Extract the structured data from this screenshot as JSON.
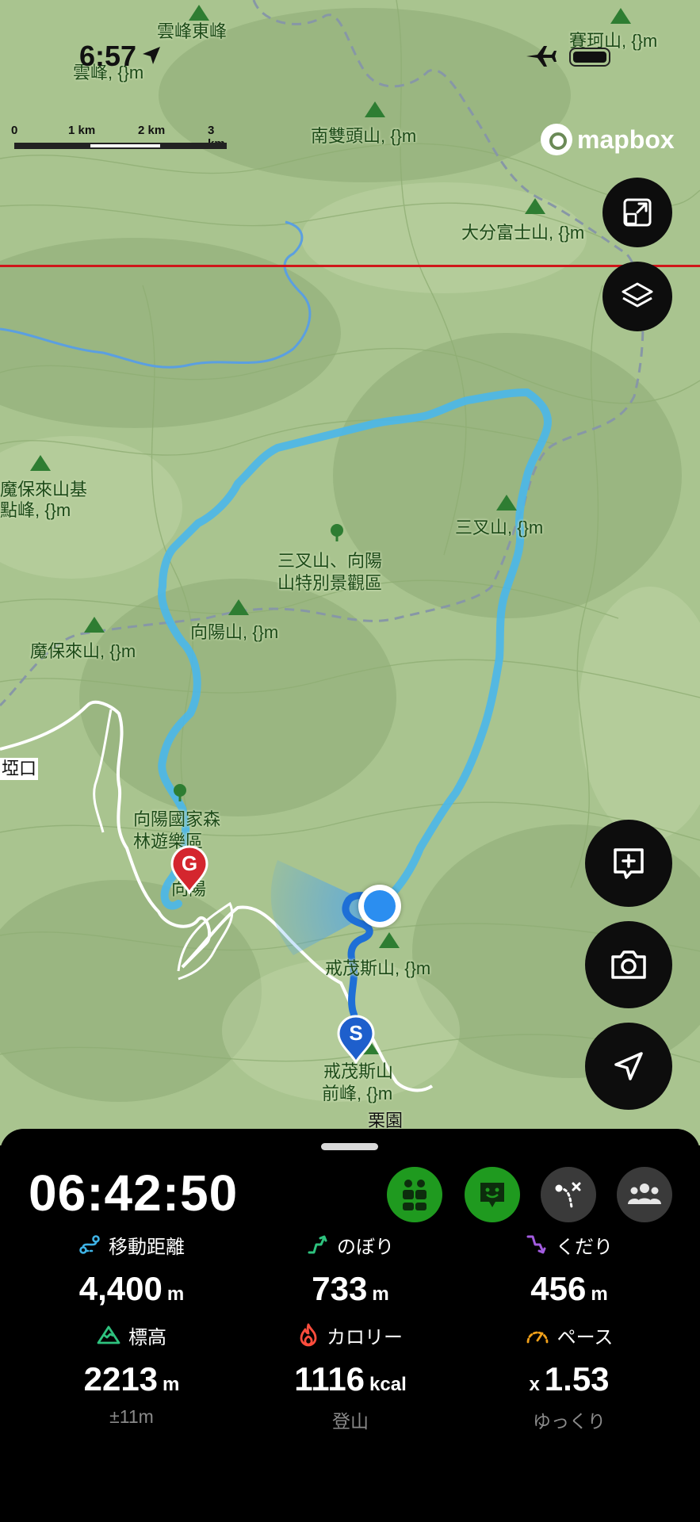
{
  "status_bar": {
    "time": "6:57"
  },
  "scale": {
    "ticks": [
      "0",
      "1 km",
      "2 km",
      "3 km"
    ]
  },
  "map_attribution": "mapbox",
  "map_labels": [
    "雲峰東峰",
    "雲峰, {}m",
    "賽珂山, {}m",
    "南雙頭山, {}m",
    "大分富士山, {}m",
    "魔保來山基",
    "點峰, {}m",
    "三叉山, {}m",
    "三叉山、向陽",
    "山特別景觀區",
    "向陽山, {}m",
    "魔保來山, {}m",
    "埡口",
    "向陽國家森",
    "林遊樂區",
    "向陽",
    "戒茂斯山, {}m",
    "戒茂斯山",
    "前峰, {}m",
    "栗園"
  ],
  "markers": {
    "goal": "G",
    "start": "S"
  },
  "map_buttons": {
    "fit_icon": "fit-screen-icon",
    "layers_icon": "layers-icon",
    "add_icon": "add-memo-icon",
    "camera_icon": "camera-icon",
    "locate_icon": "location-arrow-icon"
  },
  "sheet": {
    "elapsed_time": "06:42:50",
    "mode_buttons": [
      {
        "icon": "people-pin-icon",
        "active": true
      },
      {
        "icon": "smile-card-icon",
        "active": true
      },
      {
        "icon": "route-icon",
        "active": false
      },
      {
        "icon": "group-icon",
        "active": false
      }
    ],
    "stats": {
      "distance": {
        "label": "移動距離",
        "value": "4,400",
        "unit": "m",
        "icon": "route-icon",
        "color": "#3fb3e6"
      },
      "ascent": {
        "label": "のぼり",
        "value": "733",
        "unit": "m",
        "icon": "ascent-arrow-icon",
        "color": "#2ec27e"
      },
      "descent": {
        "label": "くだり",
        "value": "456",
        "unit": "m",
        "icon": "descent-arrow-icon",
        "color": "#a35ce0"
      },
      "altitude": {
        "label": "標高",
        "value": "2213",
        "unit": "m",
        "sub": "±11m",
        "icon": "mountain-icon",
        "color": "#2ec27e"
      },
      "calories": {
        "label": "カロリー",
        "value": "1116",
        "unit": "kcal",
        "sub": "登山",
        "icon": "flame-icon",
        "color": "#ff4d3d"
      },
      "pace": {
        "label": "ペース",
        "prefix": "x",
        "value": "1.53",
        "sub": "ゆっくり",
        "icon": "speedometer-icon",
        "color": "#f2a11a"
      }
    }
  }
}
